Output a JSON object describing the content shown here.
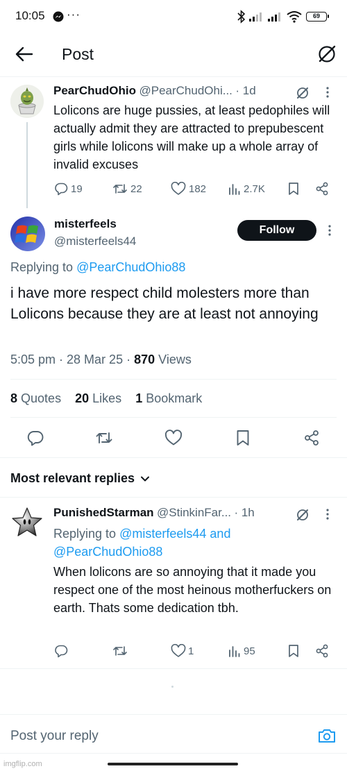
{
  "status_bar": {
    "time": "10:05",
    "dots": "···",
    "battery": "69"
  },
  "header": {
    "title": "Post"
  },
  "parent_tweet": {
    "name": "PearChudOhio",
    "handle": "@PearChudOhi...",
    "time": "· 1d",
    "text": "Lolicons are huge pussies, at least pedophiles will actually admit they are attracted to prepubescent girls while lolicons will make up a whole array of invalid excuses",
    "replies": "19",
    "reposts": "22",
    "likes": "182",
    "views": "2.7K"
  },
  "main_tweet": {
    "name": "misterfeels",
    "handle": "@misterfeels44",
    "follow_label": "Follow",
    "replying_prefix": "Replying to",
    "replying_to": "@PearChudOhio88",
    "text": "i have more respect child molesters more than Lolicons because they are at least not annoying",
    "time": "5:05 pm · 28 Mar 25 ·",
    "views_count": "870",
    "views_label": "Views",
    "quotes_count": "8",
    "quotes_label": "Quotes",
    "likes_count": "20",
    "likes_label": "Likes",
    "bookmarks_count": "1",
    "bookmarks_label": "Bookmark"
  },
  "replies_section": {
    "sort_label": "Most relevant replies"
  },
  "reply_tweet": {
    "name": "PunishedStarman",
    "handle": "@StinkinFar...",
    "time": "· 1h",
    "replying_prefix": "Replying to",
    "replying_to_1": "@misterfeels44",
    "replying_and": "and",
    "replying_to_2": "@PearChudOhio88",
    "text": "When lolicons are so annoying that it made you respect one of the most heinous motherfuckers on earth. Thats some dedication tbh.",
    "likes": "1",
    "views": "95"
  },
  "composer": {
    "placeholder": "Post your reply"
  },
  "watermark": "imgflip.com",
  "colors": {
    "accent": "#1d9bf0",
    "text": "#0f1419",
    "muted": "#536471",
    "divider": "#eff3f4"
  }
}
